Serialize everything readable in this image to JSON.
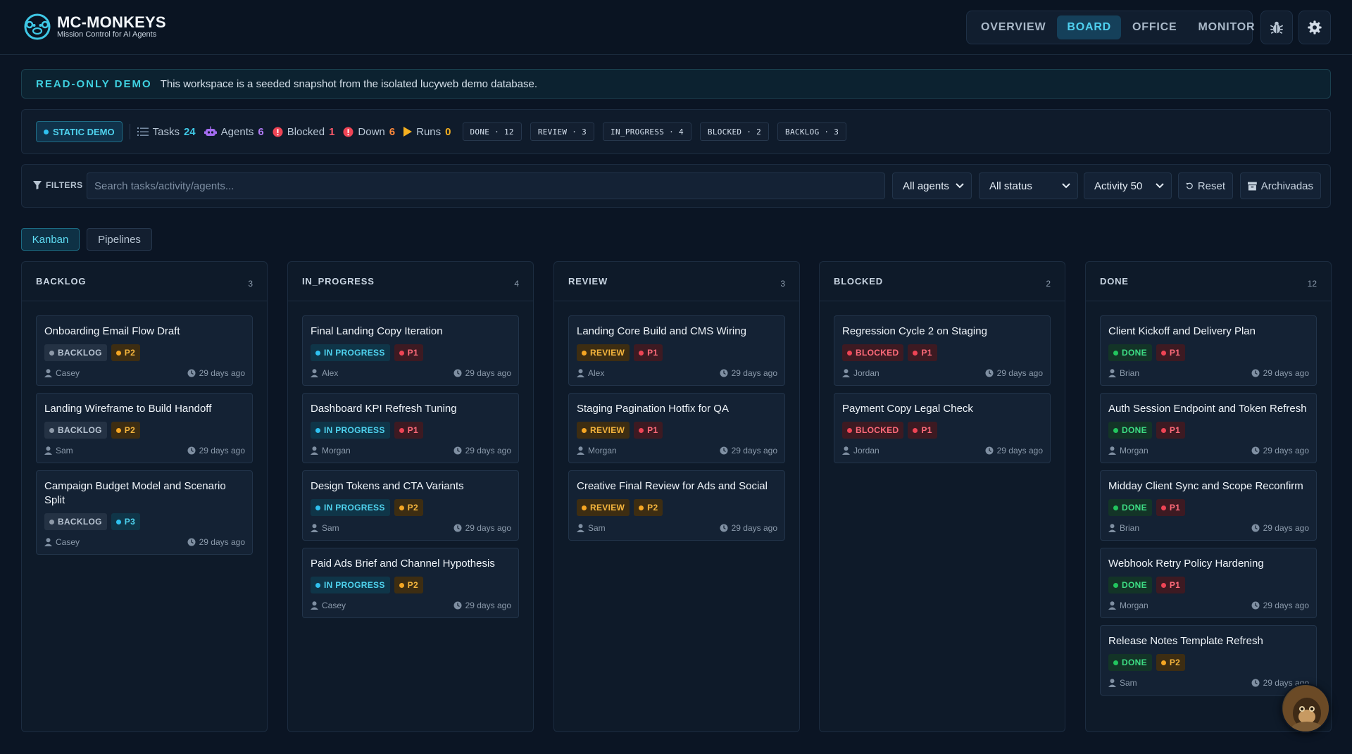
{
  "brand": {
    "title": "MC-MONKEYS",
    "subtitle": "Mission Control for AI Agents"
  },
  "nav": {
    "tabs": [
      "OVERVIEW",
      "BOARD",
      "OFFICE",
      "MONITOR"
    ],
    "active": "BOARD"
  },
  "banner": {
    "title": "READ-ONLY DEMO",
    "text": "This workspace is a seeded snapshot from the isolated lucyweb demo database."
  },
  "stats": {
    "badge": "STATIC DEMO",
    "tasks_label": "Tasks",
    "tasks": "24",
    "agents_label": "Agents",
    "agents": "6",
    "blocked_label": "Blocked",
    "blocked": "1",
    "down_label": "Down",
    "down": "6",
    "runs_label": "Runs",
    "runs": "0",
    "chips": [
      "DONE · 12",
      "REVIEW · 3",
      "IN_PROGRESS · 4",
      "BLOCKED · 2",
      "BACKLOG · 3"
    ]
  },
  "filters": {
    "label": "FILTERS",
    "search_placeholder": "Search tasks/activity/agents...",
    "agents_select": "All agents",
    "status_select": "All status",
    "activity_select": "Activity 50",
    "reset_label": "Reset",
    "archived_label": "Archivadas"
  },
  "views": {
    "kanban": "Kanban",
    "pipelines": "Pipelines"
  },
  "colors": {
    "accent": "#4fd0ef",
    "backlog_bg": "#243244",
    "backlog_fg": "#b8c4d2",
    "backlog_dot": "#8d99a8",
    "progress_bg": "#0f3548",
    "progress_fg": "#4fd3ef",
    "progress_dot": "#2fc1f0",
    "review_bg": "#3d2d12",
    "review_fg": "#f5b53d",
    "review_dot": "#f5a623",
    "blocked_bg": "#3d1a22",
    "blocked_fg": "#ff6b7a",
    "blocked_dot": "#ef4455",
    "done_bg": "#133427",
    "done_fg": "#3ddc84",
    "done_dot": "#22c55e",
    "p1_bg": "#3d1a22",
    "p1_fg": "#ff6b7a",
    "p1_dot": "#ef4455",
    "p2_bg": "#3d2d12",
    "p2_fg": "#f5b53d",
    "p2_dot": "#f5a623",
    "p3_bg": "#0f3548",
    "p3_fg": "#4fd3ef",
    "p3_dot": "#2fc1f0"
  },
  "columns": [
    {
      "title": "BACKLOG",
      "count": "3",
      "cards": [
        {
          "title": "Onboarding Email Flow Draft",
          "status": "BACKLOG",
          "status_key": "backlog",
          "priority": "P2",
          "assignee": "Casey",
          "time": "29 days ago"
        },
        {
          "title": "Landing Wireframe to Build Handoff",
          "status": "BACKLOG",
          "status_key": "backlog",
          "priority": "P2",
          "assignee": "Sam",
          "time": "29 days ago"
        },
        {
          "title": "Campaign Budget Model and Scenario Split",
          "status": "BACKLOG",
          "status_key": "backlog",
          "priority": "P3",
          "assignee": "Casey",
          "time": "29 days ago"
        }
      ]
    },
    {
      "title": "IN_PROGRESS",
      "count": "4",
      "cards": [
        {
          "title": "Final Landing Copy Iteration",
          "status": "IN PROGRESS",
          "status_key": "progress",
          "priority": "P1",
          "assignee": "Alex",
          "time": "29 days ago"
        },
        {
          "title": "Dashboard KPI Refresh Tuning",
          "status": "IN PROGRESS",
          "status_key": "progress",
          "priority": "P1",
          "assignee": "Morgan",
          "time": "29 days ago"
        },
        {
          "title": "Design Tokens and CTA Variants",
          "status": "IN PROGRESS",
          "status_key": "progress",
          "priority": "P2",
          "assignee": "Sam",
          "time": "29 days ago"
        },
        {
          "title": "Paid Ads Brief and Channel Hypothesis",
          "status": "IN PROGRESS",
          "status_key": "progress",
          "priority": "P2",
          "assignee": "Casey",
          "time": "29 days ago"
        }
      ]
    },
    {
      "title": "REVIEW",
      "count": "3",
      "cards": [
        {
          "title": "Landing Core Build and CMS Wiring",
          "status": "REVIEW",
          "status_key": "review",
          "priority": "P1",
          "assignee": "Alex",
          "time": "29 days ago"
        },
        {
          "title": "Staging Pagination Hotfix for QA",
          "status": "REVIEW",
          "status_key": "review",
          "priority": "P1",
          "assignee": "Morgan",
          "time": "29 days ago"
        },
        {
          "title": "Creative Final Review for Ads and Social",
          "status": "REVIEW",
          "status_key": "review",
          "priority": "P2",
          "assignee": "Sam",
          "time": "29 days ago"
        }
      ]
    },
    {
      "title": "BLOCKED",
      "count": "2",
      "cards": [
        {
          "title": "Regression Cycle 2 on Staging",
          "status": "BLOCKED",
          "status_key": "blocked",
          "priority": "P1",
          "assignee": "Jordan",
          "time": "29 days ago"
        },
        {
          "title": "Payment Copy Legal Check",
          "status": "BLOCKED",
          "status_key": "blocked",
          "priority": "P1",
          "assignee": "Jordan",
          "time": "29 days ago"
        }
      ]
    },
    {
      "title": "DONE",
      "count": "12",
      "cards": [
        {
          "title": "Client Kickoff and Delivery Plan",
          "status": "DONE",
          "status_key": "done",
          "priority": "P1",
          "assignee": "Brian",
          "time": "29 days ago"
        },
        {
          "title": "Auth Session Endpoint and Token Refresh",
          "status": "DONE",
          "status_key": "done",
          "priority": "P1",
          "assignee": "Morgan",
          "time": "29 days ago"
        },
        {
          "title": "Midday Client Sync and Scope Reconfirm",
          "status": "DONE",
          "status_key": "done",
          "priority": "P1",
          "assignee": "Brian",
          "time": "29 days ago"
        },
        {
          "title": "Webhook Retry Policy Hardening",
          "status": "DONE",
          "status_key": "done",
          "priority": "P1",
          "assignee": "Morgan",
          "time": "29 days ago"
        },
        {
          "title": "Release Notes Template Refresh",
          "status": "DONE",
          "status_key": "done",
          "priority": "P2",
          "assignee": "Sam",
          "time": "29 days ago"
        }
      ]
    }
  ]
}
